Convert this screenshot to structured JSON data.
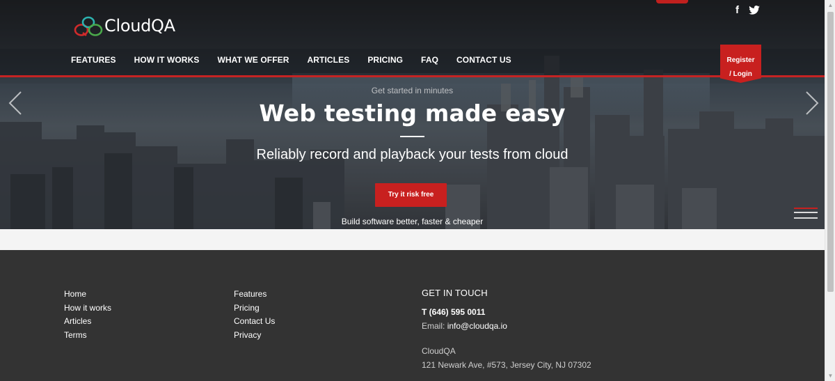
{
  "brand": {
    "name": "CloudQA"
  },
  "social": [
    {
      "icon": "facebook-icon",
      "glyph": "f"
    },
    {
      "icon": "twitter-icon",
      "glyph": "🐦"
    }
  ],
  "nav": {
    "items": [
      "FEATURES",
      "HOW IT WORKS",
      "WHAT WE OFFER",
      "ARTICLES",
      "PRICING",
      "FAQ",
      "CONTACT US"
    ],
    "register_line1": "Register",
    "register_line2": "/ Login"
  },
  "hero": {
    "pre": "Get started in minutes",
    "headline": "Web testing made easy",
    "tagline": "Reliably record and playback your tests from cloud",
    "cta": "Try it risk free",
    "post": "Build software better, faster & cheaper"
  },
  "footer": {
    "col1": [
      "Home",
      "How it works",
      "Articles",
      "Terms"
    ],
    "col2": [
      "Features",
      "Pricing",
      "Contact Us",
      "Privacy"
    ],
    "contact": {
      "heading": "GET IN TOUCH",
      "phone": "T (646) 595 0011",
      "email_label": "Email: ",
      "email": "info@cloudqa.io",
      "company": "CloudQA",
      "address": "121 Newark Ave, #573, Jersey City, NJ 07302"
    }
  },
  "colors": {
    "accent": "#c8201f",
    "footer_bg": "#333333"
  }
}
